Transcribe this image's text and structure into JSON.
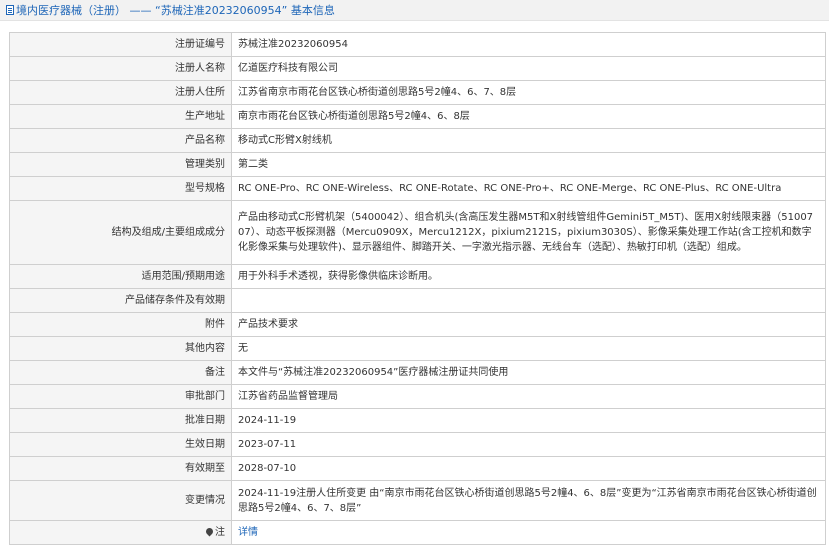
{
  "header": {
    "title": "境内医疗器械（注册） —— “苏械注准20232060954” 基本信息"
  },
  "rows": [
    {
      "label": "注册证编号",
      "value": "苏械注准20232060954"
    },
    {
      "label": "注册人名称",
      "value": "亿道医疗科技有限公司"
    },
    {
      "label": "注册人住所",
      "value": "江苏省南京市雨花台区铁心桥街道创思路5号2幢4、6、7、8层"
    },
    {
      "label": "生产地址",
      "value": "南京市雨花台区铁心桥街道创思路5号2幢4、6、8层"
    },
    {
      "label": "产品名称",
      "value": "移动式C形臂X射线机"
    },
    {
      "label": "管理类别",
      "value": "第二类"
    },
    {
      "label": "型号规格",
      "value": "RC ONE-Pro、RC ONE-Wireless、RC ONE-Rotate、RC ONE-Pro+、RC ONE-Merge、RC ONE-Plus、RC ONE-Ultra"
    },
    {
      "label": "结构及组成/主要组成成分",
      "value": "产品由移动式C形臂机架（5400042）、组合机头(含高压发生器M5T和X射线管组件Gemini5T_M5T)、医用X射线限束器（5100707）、动态平板探测器（Mercu0909X，Mercu1212X，pixium2121S，pixium3030S）、影像采集处理工作站(含工控机和数字化影像采集与处理软件)、显示器组件、脚踏开关、一字激光指示器、无线台车（选配）、热敏打印机（选配）组成。"
    },
    {
      "label": "适用范围/预期用途",
      "value": "用于外科手术透视，获得影像供临床诊断用。"
    },
    {
      "label": "产品储存条件及有效期",
      "value": ""
    },
    {
      "label": "附件",
      "value": "产品技术要求"
    },
    {
      "label": "其他内容",
      "value": "无"
    },
    {
      "label": "备注",
      "value": "本文件与“苏械注准20232060954”医疗器械注册证共同使用"
    },
    {
      "label": "审批部门",
      "value": "江苏省药品监督管理局"
    },
    {
      "label": "批准日期",
      "value": "2024-11-19"
    },
    {
      "label": "生效日期",
      "value": "2023-07-11"
    },
    {
      "label": "有效期至",
      "value": "2028-07-10"
    },
    {
      "label": "变更情况",
      "value": "2024-11-19注册人住所变更 由“南京市雨花台区铁心桥街道创思路5号2幢4、6、8层”变更为“江苏省南京市雨花台区铁心桥街道创思路5号2幢4、6、7、8层”"
    }
  ],
  "note_row": {
    "label": "注",
    "icon": "pin-icon",
    "link_text": "详情"
  },
  "colors": {
    "title": "#1e66b8",
    "link": "#1e66b8",
    "label_bg": "#f5f5f5",
    "border": "#cfcfcf"
  }
}
